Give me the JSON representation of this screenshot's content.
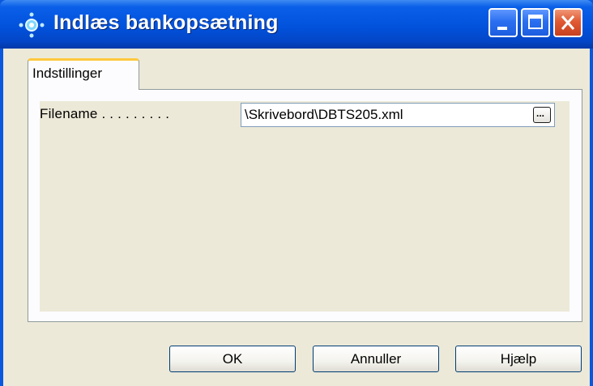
{
  "window": {
    "title": "Indlæs bankopsætning",
    "icon": "app-globe-icon",
    "controls": {
      "minimize": "minimize-icon",
      "maximize": "maximize-icon",
      "close": "close-icon"
    },
    "accent_color": "#0a58de"
  },
  "tabs": [
    {
      "label": "Indstillinger",
      "active": true
    }
  ],
  "form": {
    "filename_label": "Filename . . . . . . . . .",
    "filename_value": "\\Skrivebord\\DBTS205.xml",
    "browse_label": "..."
  },
  "buttons": {
    "ok": "OK",
    "cancel": "Annuller",
    "help": "Hjælp"
  }
}
